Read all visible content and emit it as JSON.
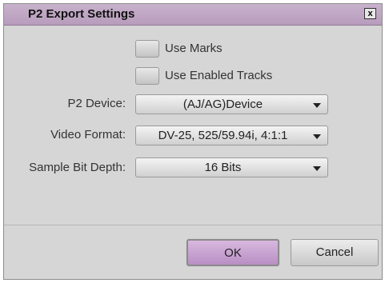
{
  "window": {
    "title": "P2 Export Settings",
    "close_glyph": "x"
  },
  "options": {
    "use_marks": {
      "label": "Use Marks",
      "checked": false
    },
    "use_enabled_tracks": {
      "label": "Use Enabled Tracks",
      "checked": false
    }
  },
  "fields": {
    "p2_device": {
      "label": "P2 Device:",
      "value": "(AJ/AG)Device"
    },
    "video_format": {
      "label": "Video Format:",
      "value": "DV-25, 525/59.94i, 4:1:1"
    },
    "sample_bit_depth": {
      "label": "Sample Bit Depth:",
      "value": "16 Bits"
    }
  },
  "buttons": {
    "ok": "OK",
    "cancel": "Cancel"
  },
  "colors": {
    "title_bar": "#c0a6c5",
    "dialog_bg": "#d6d6d6",
    "ok_button": "#c9a3d1"
  }
}
